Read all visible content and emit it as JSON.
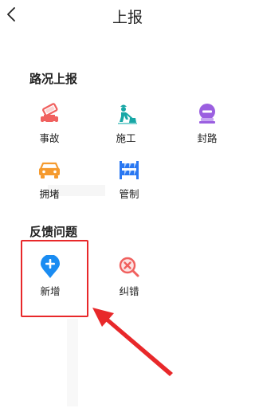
{
  "header": {
    "title": "上报",
    "back_icon": "chevron-left-icon"
  },
  "road_section": {
    "title": "路况上报",
    "items": [
      {
        "label": "事故",
        "icon": "accident-icon",
        "color": "#f0605e"
      },
      {
        "label": "施工",
        "icon": "construction-worker-icon",
        "color": "#18a7a6"
      },
      {
        "label": "封路",
        "icon": "road-closed-icon",
        "color": "#9b5fe0"
      },
      {
        "label": "拥堵",
        "icon": "traffic-jam-car-icon",
        "color": "#f59a2e"
      },
      {
        "label": "管制",
        "icon": "barrier-icon",
        "color": "#2a78f2"
      }
    ]
  },
  "feedback_section": {
    "title": "反馈问题",
    "items": [
      {
        "label": "新增",
        "icon": "add-location-pin-icon",
        "color": "#1a8cf2"
      },
      {
        "label": "纠错",
        "icon": "error-search-icon",
        "color": "#f0605e"
      }
    ]
  },
  "annotation": {
    "highlight_color": "#e8282a"
  }
}
